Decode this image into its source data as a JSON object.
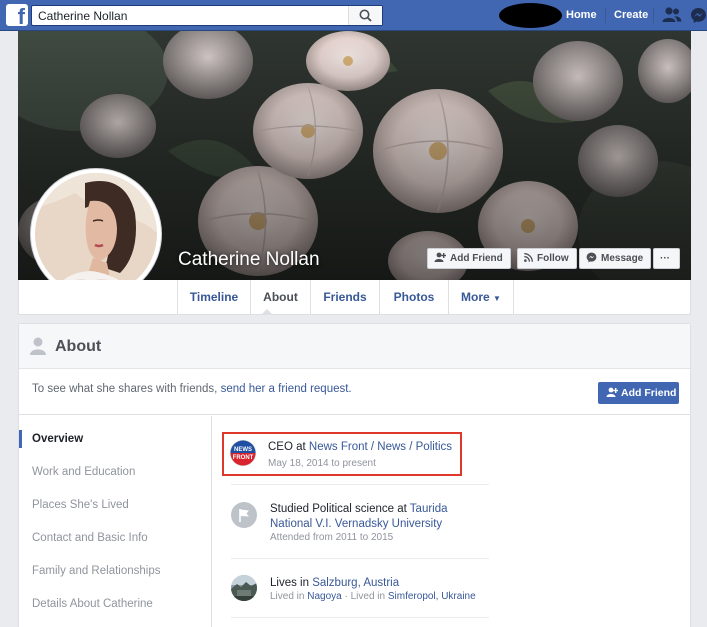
{
  "topbar": {
    "logo": "f",
    "search_value": "Catherine Nollan",
    "home": "Home",
    "create": "Create",
    "icons": [
      "search-icon",
      "friends-icon",
      "messenger-icon"
    ]
  },
  "profile": {
    "name": "Catherine Nollan",
    "buttons": {
      "add_friend": "Add Friend",
      "follow": "Follow",
      "message": "Message",
      "more": "···"
    }
  },
  "tabs": [
    "Timeline",
    "About",
    "Friends",
    "Photos",
    "More"
  ],
  "about": {
    "title": "About",
    "friend_prompt": "To see what she shares with friends, ",
    "friend_link": "send her a friend request.",
    "add_friend": "Add Friend",
    "left_nav": [
      "Overview",
      "Work and Education",
      "Places She's Lived",
      "Contact and Basic Info",
      "Family and Relationships",
      "Details About Catherine"
    ],
    "entries": {
      "work": {
        "prefix": "CEO at ",
        "employer": "News Front / News / Politics",
        "date": "May 18, 2014 to present",
        "logo_text_1": "NEWS",
        "logo_text_2": "FRONT"
      },
      "education": {
        "prefix": "Studied Political science at ",
        "school_line1": "Taurida",
        "school_line2": "National V.I. Vernadsky University",
        "date": "Attended from 2011 to 2015"
      },
      "places": {
        "prefix": "Lives in ",
        "city": "Salzburg, Austria",
        "lived_label_1": "Lived in ",
        "lived_city_1": "Nagoya",
        "dot": " · ",
        "lived_label_2": "Lived in ",
        "lived_city_2": "Simferopol, Ukraine"
      }
    }
  },
  "colors": {
    "fb_blue": "#4267b2",
    "link": "#385898",
    "highlight": "#e0372b"
  }
}
